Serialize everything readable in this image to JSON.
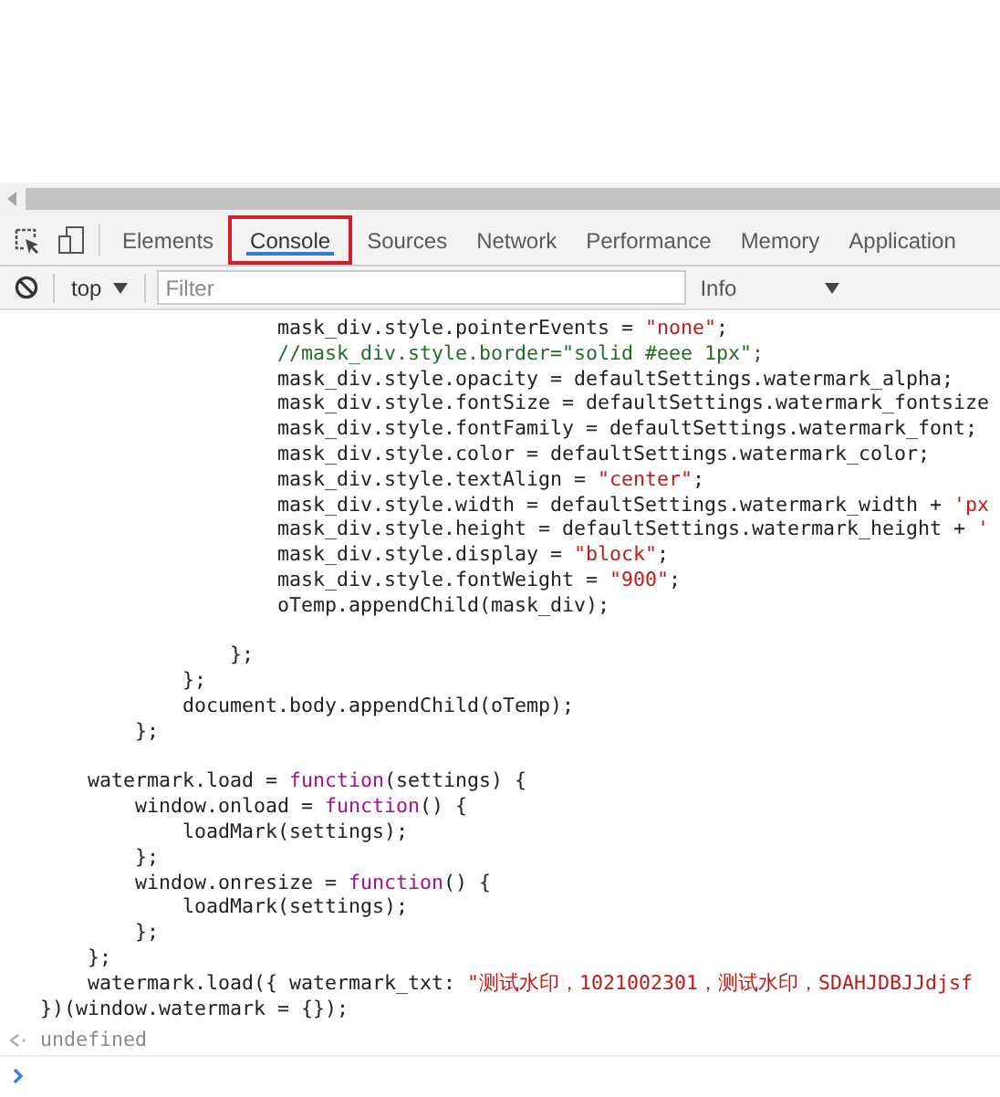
{
  "tabs": [
    {
      "label": "Elements",
      "selected": false
    },
    {
      "label": "Console",
      "selected": true
    },
    {
      "label": "Sources",
      "selected": false
    },
    {
      "label": "Network",
      "selected": false
    },
    {
      "label": "Performance",
      "selected": false
    },
    {
      "label": "Memory",
      "selected": false
    },
    {
      "label": "Application",
      "selected": false
    }
  ],
  "console_toolbar": {
    "context": "top",
    "filter": {
      "placeholder": "Filter"
    },
    "log_level": "Info"
  },
  "code_lines": [
    {
      "gap_before": false,
      "tokens": [
        {
          "kind": "plain",
          "text": "                    mask_div.style.pointerEvents = "
        },
        {
          "kind": "string",
          "text": "\"none\""
        },
        {
          "kind": "plain",
          "text": ";"
        }
      ]
    },
    {
      "gap_before": false,
      "tokens": [
        {
          "kind": "comment",
          "text": "                    //mask_div.style.border=\"solid #eee 1px\";"
        }
      ]
    },
    {
      "gap_before": false,
      "tokens": [
        {
          "kind": "plain",
          "text": "                    mask_div.style.opacity = defaultSettings.watermark_alpha;"
        }
      ]
    },
    {
      "gap_before": false,
      "tokens": [
        {
          "kind": "plain",
          "text": "                    mask_div.style.fontSize = defaultSettings.watermark_fontsize"
        }
      ]
    },
    {
      "gap_before": false,
      "tokens": [
        {
          "kind": "plain",
          "text": "                    mask_div.style.fontFamily = defaultSettings.watermark_font;"
        }
      ]
    },
    {
      "gap_before": false,
      "tokens": [
        {
          "kind": "plain",
          "text": "                    mask_div.style.color = defaultSettings.watermark_color;"
        }
      ]
    },
    {
      "gap_before": false,
      "tokens": [
        {
          "kind": "plain",
          "text": "                    mask_div.style.textAlign = "
        },
        {
          "kind": "string",
          "text": "\"center\""
        },
        {
          "kind": "plain",
          "text": ";"
        }
      ]
    },
    {
      "gap_before": false,
      "tokens": [
        {
          "kind": "plain",
          "text": "                    mask_div.style.width = defaultSettings.watermark_width + "
        },
        {
          "kind": "string",
          "text": "'px"
        }
      ]
    },
    {
      "gap_before": false,
      "tokens": [
        {
          "kind": "plain",
          "text": "                    mask_div.style.height = defaultSettings.watermark_height + "
        },
        {
          "kind": "string",
          "text": "'"
        }
      ]
    },
    {
      "gap_before": false,
      "tokens": [
        {
          "kind": "plain",
          "text": "                    mask_div.style.display = "
        },
        {
          "kind": "string",
          "text": "\"block\""
        },
        {
          "kind": "plain",
          "text": ";"
        }
      ]
    },
    {
      "gap_before": false,
      "tokens": [
        {
          "kind": "plain",
          "text": "                    mask_div.style.fontWeight = "
        },
        {
          "kind": "string",
          "text": "\"900\""
        },
        {
          "kind": "plain",
          "text": ";"
        }
      ]
    },
    {
      "gap_before": false,
      "tokens": [
        {
          "kind": "plain",
          "text": "                    oTemp.appendChild(mask_div);"
        }
      ]
    },
    {
      "gap_before": true,
      "tokens": [
        {
          "kind": "plain",
          "text": "                };"
        }
      ]
    },
    {
      "gap_before": false,
      "tokens": [
        {
          "kind": "plain",
          "text": "            };"
        }
      ]
    },
    {
      "gap_before": false,
      "tokens": [
        {
          "kind": "plain",
          "text": "            document.body.appendChild(oTemp);"
        }
      ]
    },
    {
      "gap_before": false,
      "tokens": [
        {
          "kind": "plain",
          "text": "        };"
        }
      ]
    },
    {
      "gap_before": true,
      "tokens": [
        {
          "kind": "plain",
          "text": "    watermark.load = "
        },
        {
          "kind": "keyword",
          "text": "function"
        },
        {
          "kind": "plain",
          "text": "(settings) {"
        }
      ]
    },
    {
      "gap_before": false,
      "tokens": [
        {
          "kind": "plain",
          "text": "        window.onload = "
        },
        {
          "kind": "keyword",
          "text": "function"
        },
        {
          "kind": "plain",
          "text": "() {"
        }
      ]
    },
    {
      "gap_before": false,
      "tokens": [
        {
          "kind": "plain",
          "text": "            loadMark(settings);"
        }
      ]
    },
    {
      "gap_before": false,
      "tokens": [
        {
          "kind": "plain",
          "text": "        };"
        }
      ]
    },
    {
      "gap_before": false,
      "tokens": [
        {
          "kind": "plain",
          "text": "        window.onresize = "
        },
        {
          "kind": "keyword",
          "text": "function"
        },
        {
          "kind": "plain",
          "text": "() {"
        }
      ]
    },
    {
      "gap_before": false,
      "tokens": [
        {
          "kind": "plain",
          "text": "            loadMark(settings);"
        }
      ]
    },
    {
      "gap_before": false,
      "tokens": [
        {
          "kind": "plain",
          "text": "        };"
        }
      ]
    },
    {
      "gap_before": false,
      "tokens": [
        {
          "kind": "plain",
          "text": "    };"
        }
      ]
    },
    {
      "gap_before": false,
      "tokens": [
        {
          "kind": "plain",
          "text": "    watermark.load({ watermark_txt: "
        },
        {
          "kind": "string",
          "text": "\"测试水印，1021002301，测试水印，SDAHJDBJJdjsf"
        }
      ]
    },
    {
      "gap_before": false,
      "tokens": [
        {
          "kind": "plain",
          "text": "})(window.watermark = {});"
        }
      ]
    }
  ],
  "result": {
    "text": "undefined"
  }
}
